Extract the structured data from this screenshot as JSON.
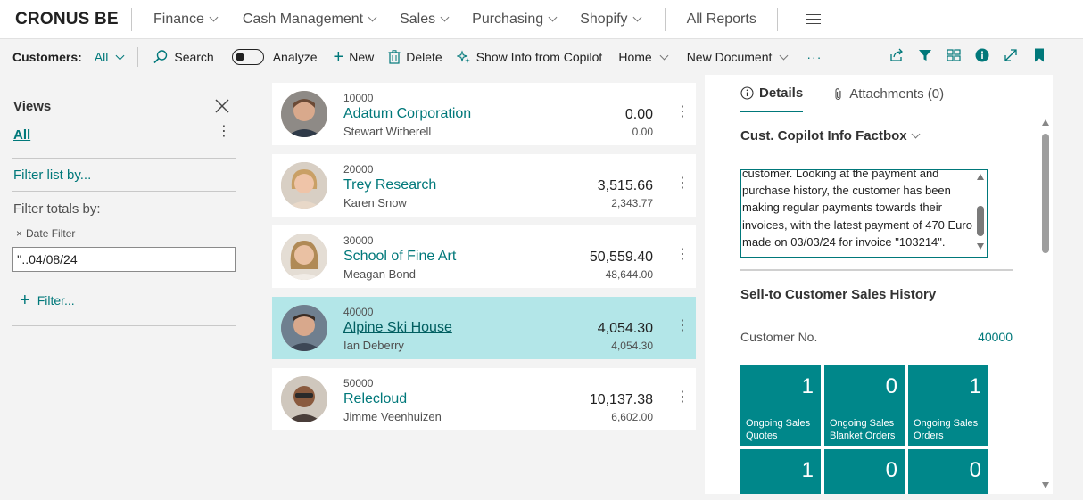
{
  "topnav": {
    "brand": "CRONUS BE",
    "items": [
      {
        "label": "Finance",
        "dropdown": true
      },
      {
        "label": "Cash Management",
        "dropdown": true
      },
      {
        "label": "Sales",
        "dropdown": true
      },
      {
        "label": "Purchasing",
        "dropdown": true
      },
      {
        "label": "Shopify",
        "dropdown": true
      }
    ],
    "all_reports": "All Reports",
    "menu_icon": "hamburger-icon"
  },
  "actionbar": {
    "page_label": "Customers:",
    "view_selector": "All",
    "search": "Search",
    "analyze": "Analyze",
    "new": "New",
    "delete": "Delete",
    "copilot": "Show Info from Copilot",
    "home": "Home",
    "new_document": "New Document",
    "more": "···",
    "right_icons": [
      "share-icon",
      "filter-icon",
      "layout-icon",
      "info-icon",
      "expand-icon",
      "bookmark-icon"
    ]
  },
  "filterpane": {
    "views_title": "Views",
    "view_all": "All",
    "filter_list_by": "Filter list by...",
    "filter_totals_by": "Filter totals by:",
    "date_filter_label": "Date Filter",
    "date_filter_value": "''..04/08/24",
    "add_filter": "Filter..."
  },
  "customers": [
    {
      "no": "10000",
      "name": "Adatum Corporation",
      "contact": "Stewart Witherell",
      "balance": "0.00",
      "sub": "0.00",
      "selected": false
    },
    {
      "no": "20000",
      "name": "Trey Research",
      "contact": "Karen Snow",
      "balance": "3,515.66",
      "sub": "2,343.77",
      "selected": false
    },
    {
      "no": "30000",
      "name": "School of Fine Art",
      "contact": "Meagan Bond",
      "balance": "50,559.40",
      "sub": "48,644.00",
      "selected": false
    },
    {
      "no": "40000",
      "name": "Alpine Ski House",
      "contact": "Ian Deberry",
      "balance": "4,054.30",
      "sub": "4,054.30",
      "selected": true
    },
    {
      "no": "50000",
      "name": "Relecloud",
      "contact": "Jimme Veenhuizen",
      "balance": "10,137.38",
      "sub": "6,602.00",
      "selected": false
    }
  ],
  "factbox": {
    "tab_details": "Details",
    "tab_attachments": "Attachments (0)",
    "copilot_title": "Cust. Copilot Info Factbox",
    "copilot_lines": [
      "customer. Looking at the payment and",
      "purchase history, the customer has been",
      "making regular payments towards their",
      "invoices, with the latest payment of 470 Euro",
      "made on 03/03/24 for invoice \"103214\"."
    ],
    "sales_history_title": "Sell-to Customer Sales History",
    "customer_no_label": "Customer No.",
    "customer_no_value": "40000",
    "tiles": [
      {
        "value": "1",
        "label1": "Ongoing Sales",
        "label2": "Quotes"
      },
      {
        "value": "0",
        "label1": "Ongoing Sales",
        "label2": "Blanket Orders"
      },
      {
        "value": "1",
        "label1": "Ongoing Sales",
        "label2": "Orders"
      },
      {
        "value": "1",
        "label1": "",
        "label2": ""
      },
      {
        "value": "0",
        "label1": "",
        "label2": ""
      },
      {
        "value": "0",
        "label1": "",
        "label2": ""
      }
    ]
  },
  "colors": {
    "accent": "#00787a",
    "tile": "#00878a",
    "selected_row": "#b3e6e8"
  }
}
